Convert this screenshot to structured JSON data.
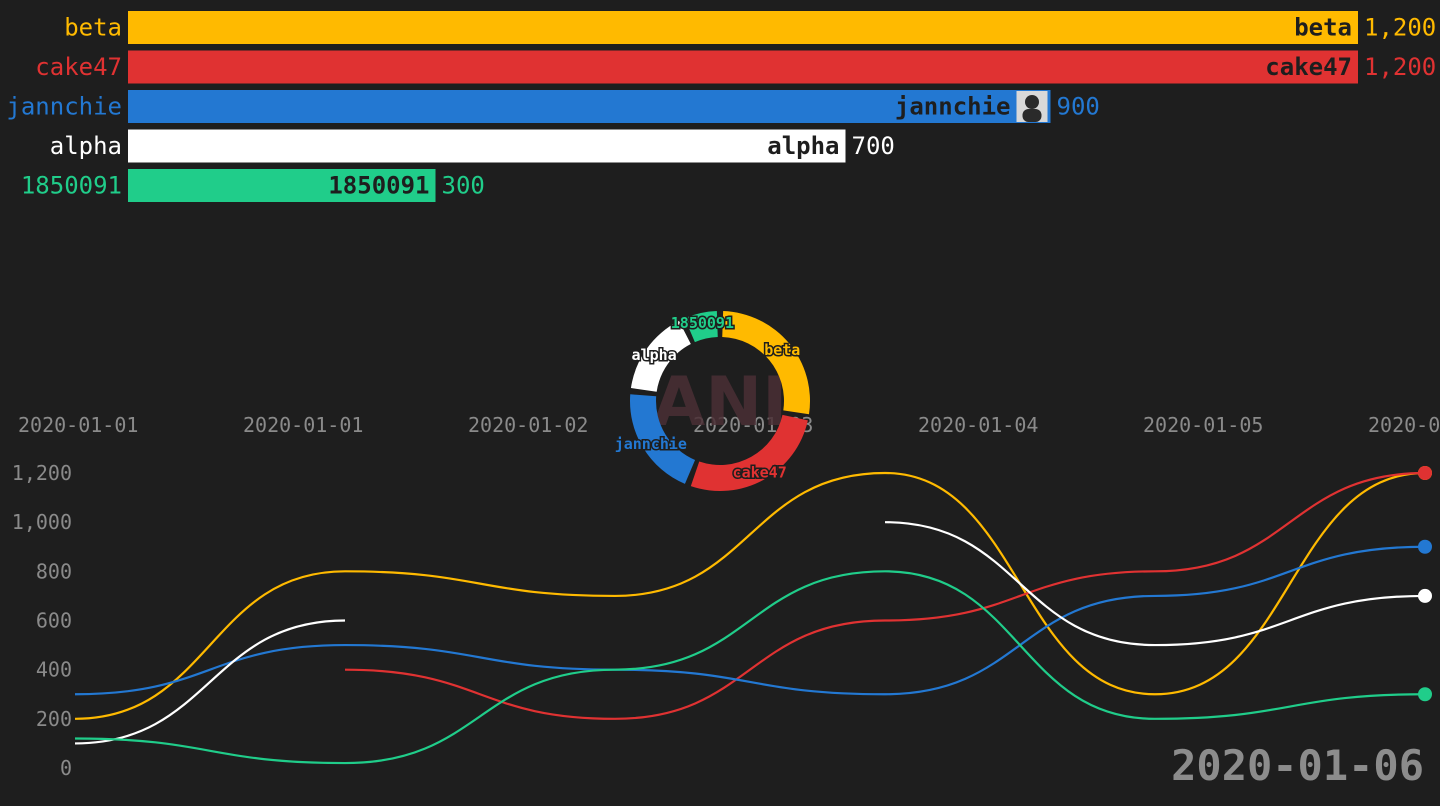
{
  "colors": {
    "background": "#1e1e1e",
    "beta": "#ffba00",
    "cake47": "#e03232",
    "jannchie": "#2378d2",
    "alpha": "#ffffff",
    "1850091": "#20cd8a",
    "axis_text": "#8a8a8a",
    "date_text": "#8c8c8c"
  },
  "chart_data": [
    {
      "type": "bar",
      "orientation": "horizontal",
      "categories": [
        "beta",
        "cake47",
        "jannchie",
        "alpha",
        "1850091"
      ],
      "values": [
        1200,
        1200,
        900,
        700,
        300
      ],
      "value_labels": [
        "1,200",
        "1,200",
        "900",
        "700",
        "300"
      ],
      "xlim": [
        0,
        1200
      ],
      "avatar_on": "jannchie"
    },
    {
      "type": "pie",
      "donut": true,
      "labels": [
        "beta",
        "cake47",
        "jannchie",
        "alpha",
        "1850091"
      ],
      "values": [
        1200,
        1200,
        900,
        700,
        300
      ],
      "center_watermark": "ANI"
    },
    {
      "type": "line",
      "x": [
        "2020-01-01",
        "2020-01-02",
        "2020-01-03",
        "2020-01-04",
        "2020-01-05",
        "2020-01-06"
      ],
      "x_tick_labels": [
        "2020-01-01",
        "2020-01-01",
        "2020-01-02",
        "2020-01-03",
        "2020-01-04",
        "2020-01-05",
        "2020-0"
      ],
      "y_tick_labels": [
        "1,200",
        "1,000",
        "800",
        "600",
        "400",
        "200",
        "0"
      ],
      "ylim": [
        0,
        1200
      ],
      "current_date": "2020-01-06",
      "series": [
        {
          "name": "beta",
          "values": [
            200,
            800,
            700,
            1200,
            300,
            1200
          ]
        },
        {
          "name": "cake47",
          "values": [
            null,
            400,
            200,
            600,
            800,
            1200
          ]
        },
        {
          "name": "jannchie",
          "values": [
            300,
            500,
            400,
            300,
            700,
            900
          ]
        },
        {
          "name": "alpha",
          "values": [
            100,
            600,
            null,
            1000,
            500,
            700
          ]
        },
        {
          "name": "1850091",
          "values": [
            120,
            20,
            400,
            800,
            200,
            300
          ]
        }
      ]
    }
  ]
}
